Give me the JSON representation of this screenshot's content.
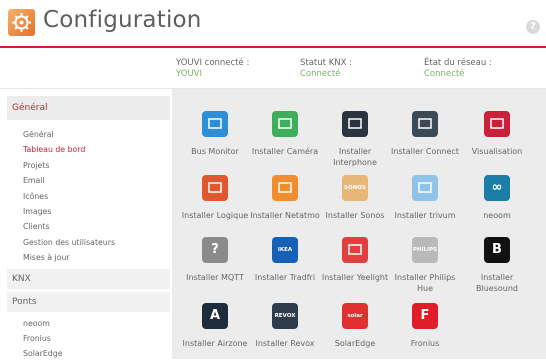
{
  "header": {
    "title": "Configuration",
    "help_icon": "help-icon",
    "accent": "#c9213a"
  },
  "status": [
    {
      "label": "YOUVI connecté :",
      "value": "YOUVI"
    },
    {
      "label": "Statut KNX :",
      "value": "Connecté"
    },
    {
      "label": "État du réseau :",
      "value": "Connecté"
    }
  ],
  "sidebar": {
    "sections": [
      {
        "title": "Général",
        "active": true,
        "items": [
          "Général",
          "Tableau de bord",
          "Projets",
          "Email",
          "Icônes",
          "Images",
          "Clients",
          "Gestion des utilisateurs",
          "Mises à jour"
        ],
        "selected": "Tableau de bord"
      },
      {
        "title": "KNX",
        "items": []
      },
      {
        "title": "Ponts",
        "items": [
          "neoom",
          "Fronius",
          "SolarEdge"
        ]
      }
    ]
  },
  "tiles": [
    {
      "label": "Bus Monitor",
      "icon": "monitor-icon",
      "color": "#2f8fd6"
    },
    {
      "label": "Installer Caméra",
      "icon": "camera-icon",
      "color": "#3fae5a"
    },
    {
      "label": "Installer Interphone",
      "icon": "interphone-icon",
      "color": "#2c3440"
    },
    {
      "label": "Installer Connect",
      "icon": "network-icon",
      "color": "#3c4a55"
    },
    {
      "label": "Visualisation",
      "icon": "visualisation-icon",
      "color": "#c9213a"
    },
    {
      "label": "Installer Logique",
      "icon": "logic-icon",
      "color": "#e0582f"
    },
    {
      "label": "Installer Netatmo",
      "icon": "netatmo-icon",
      "color": "#f08d2e"
    },
    {
      "label": "Installer Sonos",
      "icon": "sonos-icon",
      "color": "#e8b777",
      "text": "SONOS"
    },
    {
      "label": "Installer trivum",
      "icon": "trivum-icon",
      "color": "#8fc4e8"
    },
    {
      "label": "neoom",
      "icon": "neoom-icon",
      "color": "#1a7ea8",
      "text": "∞"
    },
    {
      "label": "Installer MQTT",
      "icon": "question-icon",
      "color": "#8a8a8a",
      "text": "?"
    },
    {
      "label": "Installer Tradfri",
      "icon": "ikea-icon",
      "color": "#1561b5",
      "text": "IKEA"
    },
    {
      "label": "Installer Yeelight",
      "icon": "yeelight-icon",
      "color": "#e04040"
    },
    {
      "label": "Installer Philips Hue",
      "icon": "philips-hue-icon",
      "color": "#b9b9b9",
      "text": "PHILIPS"
    },
    {
      "label": "Installer Bluesound",
      "icon": "bluesound-icon",
      "color": "#111111",
      "text": "B"
    },
    {
      "label": "Installer Airzone",
      "icon": "airzone-icon",
      "color": "#1e2c3b",
      "text": "A"
    },
    {
      "label": "Installer Revox",
      "icon": "revox-icon",
      "color": "#2e3b4a",
      "text": "REVOX"
    },
    {
      "label": "SolarEdge",
      "icon": "solaredge-icon",
      "color": "#e03030",
      "text": "solar"
    },
    {
      "label": "Fronius",
      "icon": "fronius-icon",
      "color": "#e01e2a",
      "text": "F"
    }
  ]
}
